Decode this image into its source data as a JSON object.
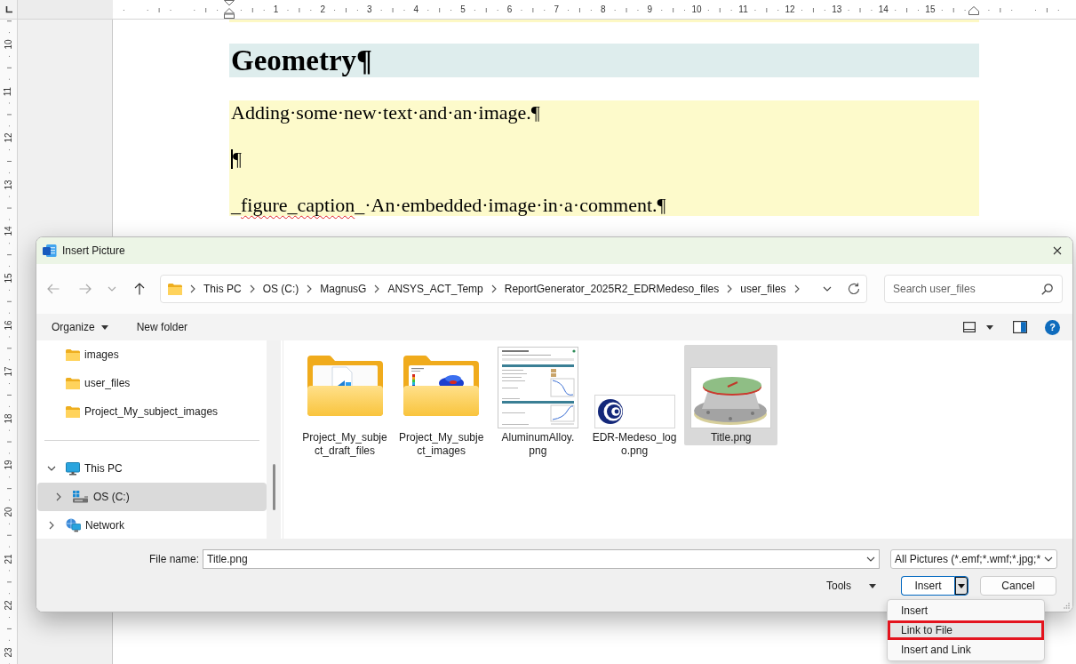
{
  "ruler": {
    "top_numbers": [
      "1",
      "2",
      "3",
      "4",
      "5",
      "6",
      "7",
      "8",
      "9",
      "10",
      "11",
      "12",
      "13",
      "14",
      "15"
    ],
    "left_numbers": [
      "10",
      "11",
      "12",
      "13",
      "14",
      "15",
      "16",
      "17",
      "18",
      "19",
      "20",
      "21",
      "22",
      "23"
    ]
  },
  "document": {
    "heading": "Geometry¶",
    "paragraphs": [
      {
        "cursor": false,
        "runs": [
          {
            "text": "Adding·some·new·text·and·an·image.¶",
            "misspelled": false
          }
        ]
      },
      {
        "cursor": true,
        "runs": [
          {
            "text": "¶",
            "misspelled": false
          }
        ]
      },
      {
        "cursor": false,
        "runs": [
          {
            "text": "_",
            "misspelled": false
          },
          {
            "text": "figure_caption",
            "misspelled": true
          },
          {
            "text": "_·An·embedded·image·in·a·comment.¶",
            "misspelled": false
          }
        ]
      }
    ]
  },
  "dialog": {
    "title": "Insert Picture",
    "nav_buttons": [
      {
        "kind": "back",
        "disabled": true
      },
      {
        "kind": "forward",
        "disabled": true
      },
      {
        "kind": "recent",
        "disabled": true
      },
      {
        "kind": "up",
        "disabled": false
      }
    ],
    "address": [
      "This PC",
      "OS (C:)",
      "MagnusG",
      "ANSYS_ACT_Temp",
      "ReportGenerator_2025R2_EDRMedeso_files",
      "user_files"
    ],
    "search": {
      "placeholder": "Search user_files"
    },
    "toolbar": {
      "organize": "Organize",
      "new_folder": "New folder",
      "help": "?"
    },
    "quick_access": [
      {
        "label": "images",
        "selected": false
      },
      {
        "label": "user_files",
        "selected": false
      },
      {
        "label": "Project_My_subject_images",
        "selected": false
      }
    ],
    "tree": [
      {
        "label": "This PC",
        "kind": "pc",
        "expanded": true,
        "selected": false,
        "children": [
          {
            "label": "OS (C:)",
            "kind": "drive",
            "expanded": false,
            "selected": true
          }
        ]
      },
      {
        "label": "Network",
        "kind": "network",
        "expanded": false,
        "selected": false
      }
    ],
    "files": [
      {
        "name": "Project_My_subject_draft_files",
        "kind": "docfolder",
        "selected": false
      },
      {
        "name": "Project_My_subject_images",
        "kind": "imagefolder",
        "selected": false
      },
      {
        "name": "AluminumAlloy.png",
        "kind": "screenshot",
        "selected": false
      },
      {
        "name": "EDR-Medeso_logo.png",
        "kind": "logo",
        "selected": false
      },
      {
        "name": "Title.png",
        "kind": "render",
        "selected": true
      }
    ],
    "file_name": {
      "label": "File name:",
      "value": "Title.png"
    },
    "file_type": {
      "value": "All Pictures (*.emf;*.wmf;*.jpg;*"
    },
    "tools": "Tools",
    "insert_button": {
      "label": "Insert",
      "menu_open": true
    },
    "cancel": "Cancel",
    "insert_menu": [
      {
        "label": "Insert",
        "selected": false,
        "highlighted": false
      },
      {
        "label": "Link to File",
        "selected": true,
        "highlighted": true
      },
      {
        "label": "Insert and Link",
        "selected": false,
        "highlighted": false
      }
    ]
  }
}
